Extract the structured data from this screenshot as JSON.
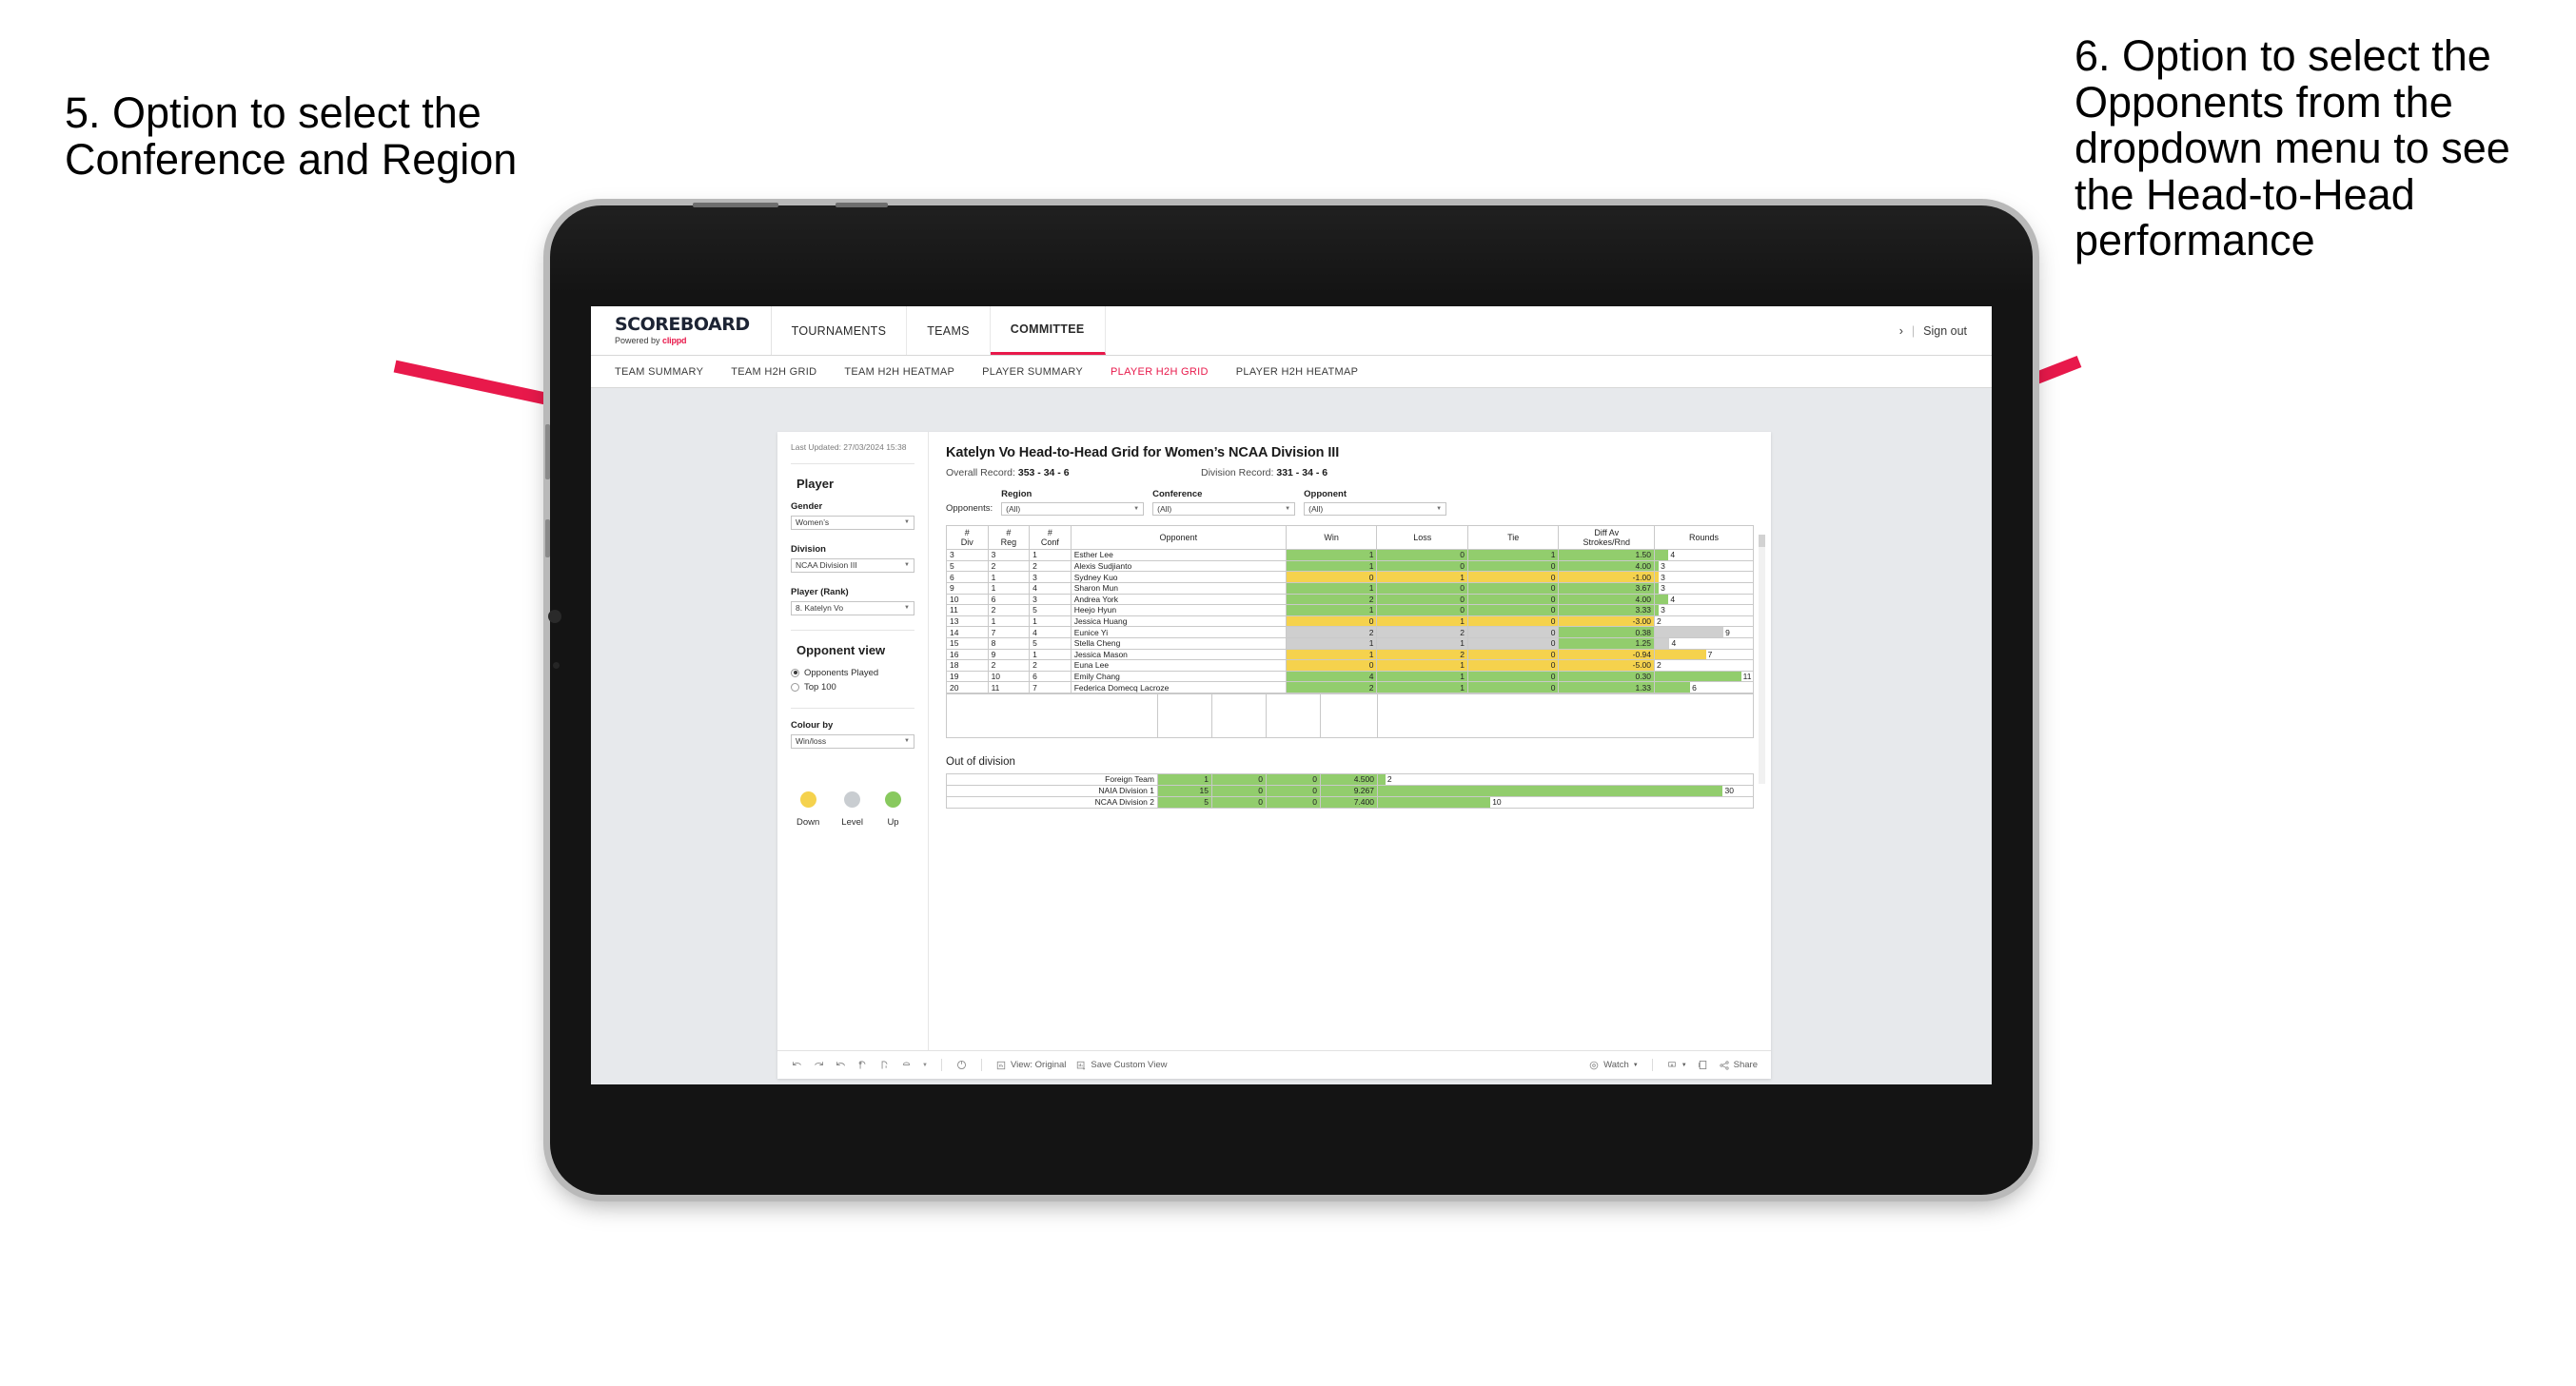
{
  "annotations": {
    "left": "5. Option to select the Conference and Region",
    "right": "6. Option to select the Opponents from the dropdown menu to see the Head-to-Head performance",
    "arrow_color": "#e8194b"
  },
  "app": {
    "brand": {
      "title": "SCOREBOARD",
      "powered_prefix": "Powered by ",
      "powered_brand": "clippd"
    },
    "top_nav": [
      {
        "label": "TOURNAMENTS",
        "active": false
      },
      {
        "label": "TEAMS",
        "active": false
      },
      {
        "label": "COMMITTEE",
        "active": true
      }
    ],
    "header_right": {
      "chevron": "›",
      "separator": "|",
      "sign_out": "Sign out"
    },
    "sub_nav": [
      {
        "label": "TEAM SUMMARY",
        "active": false
      },
      {
        "label": "TEAM H2H GRID",
        "active": false
      },
      {
        "label": "TEAM H2H HEATMAP",
        "active": false
      },
      {
        "label": "PLAYER SUMMARY",
        "active": false
      },
      {
        "label": "PLAYER H2H GRID",
        "active": true
      },
      {
        "label": "PLAYER H2H HEATMAP",
        "active": false
      }
    ]
  },
  "sidebar": {
    "last_updated": "Last Updated: 27/03/2024 15:38",
    "section_player": "Player",
    "gender": {
      "label": "Gender",
      "value": "Women’s"
    },
    "division": {
      "label": "Division",
      "value": "NCAA Division III"
    },
    "player_rank": {
      "label": "Player (Rank)",
      "value": "8. Katelyn Vo"
    },
    "opponent_view": {
      "label": "Opponent view",
      "options": [
        {
          "label": "Opponents Played",
          "checked": true
        },
        {
          "label": "Top 100",
          "checked": false
        }
      ]
    },
    "colour_by": {
      "label": "Colour by",
      "value": "Win/loss"
    },
    "legend": [
      {
        "label": "Down",
        "color": "#f5d24d"
      },
      {
        "label": "Level",
        "color": "#c9cdd1"
      },
      {
        "label": "Up",
        "color": "#88c95e"
      }
    ]
  },
  "main": {
    "title": "Katelyn Vo Head-to-Head Grid for Women’s NCAA Division III",
    "overall_record_label": "Overall Record: ",
    "overall_record_value": "353 - 34 - 6",
    "division_record_label": "Division Record: ",
    "division_record_value": "331 - 34 - 6",
    "opponents_label": "Opponents:",
    "filters": [
      {
        "label": "Region",
        "value": "(All)"
      },
      {
        "label": "Conference",
        "value": "(All)"
      },
      {
        "label": "Opponent",
        "value": "(All)"
      }
    ]
  },
  "chart_data": {
    "type": "table",
    "title": "Katelyn Vo Head-to-Head Grid for Women’s NCAA Division III",
    "columns": [
      "# Div",
      "# Reg",
      "# Conf",
      "Opponent",
      "Win",
      "Loss",
      "Tie",
      "Diff Av Strokes/Rnd",
      "Rounds"
    ],
    "column_header_lines": [
      [
        "#",
        "Div"
      ],
      [
        "#",
        "Reg"
      ],
      [
        "#",
        "Conf"
      ],
      [
        "Opponent"
      ],
      [
        "Win"
      ],
      [
        "Loss"
      ],
      [
        "Tie"
      ],
      [
        "Diff Av",
        "Strokes/Rnd"
      ],
      [
        "Rounds"
      ]
    ],
    "rows": [
      {
        "div": "3",
        "reg": "3",
        "conf": "1",
        "opponent": "Esther Lee",
        "win": "1",
        "loss": "0",
        "tie": "1",
        "diff": "1.50",
        "rounds": "4",
        "color": "green",
        "bar_pct": 14
      },
      {
        "div": "5",
        "reg": "2",
        "conf": "2",
        "opponent": "Alexis Sudjianto",
        "win": "1",
        "loss": "0",
        "tie": "0",
        "diff": "4.00",
        "rounds": "3",
        "color": "green",
        "bar_pct": 4
      },
      {
        "div": "6",
        "reg": "1",
        "conf": "3",
        "opponent": "Sydney Kuo",
        "win": "0",
        "loss": "1",
        "tie": "0",
        "diff": "-1.00",
        "rounds": "3",
        "color": "yellow",
        "bar_pct": 4
      },
      {
        "div": "9",
        "reg": "1",
        "conf": "4",
        "opponent": "Sharon Mun",
        "win": "1",
        "loss": "0",
        "tie": "0",
        "diff": "3.67",
        "rounds": "3",
        "color": "green",
        "bar_pct": 4
      },
      {
        "div": "10",
        "reg": "6",
        "conf": "3",
        "opponent": "Andrea York",
        "win": "2",
        "loss": "0",
        "tie": "0",
        "diff": "4.00",
        "rounds": "4",
        "color": "green",
        "bar_pct": 14
      },
      {
        "div": "11",
        "reg": "2",
        "conf": "5",
        "opponent": "Heejo Hyun",
        "win": "1",
        "loss": "0",
        "tie": "0",
        "diff": "3.33",
        "rounds": "3",
        "color": "green",
        "bar_pct": 4
      },
      {
        "div": "13",
        "reg": "1",
        "conf": "1",
        "opponent": "Jessica Huang",
        "win": "0",
        "loss": "1",
        "tie": "0",
        "diff": "-3.00",
        "rounds": "2",
        "color": "yellow",
        "bar_pct": 0
      },
      {
        "div": "14",
        "reg": "7",
        "conf": "4",
        "opponent": "Eunice Yi",
        "win": "2",
        "loss": "2",
        "tie": "0",
        "diff": "0.38",
        "rounds": "9",
        "color": "grey",
        "bar_pct": 70,
        "diff_color": "green"
      },
      {
        "div": "15",
        "reg": "8",
        "conf": "5",
        "opponent": "Stella Cheng",
        "win": "1",
        "loss": "1",
        "tie": "0",
        "diff": "1.25",
        "rounds": "4",
        "color": "grey",
        "bar_pct": 15,
        "diff_color": "green"
      },
      {
        "div": "16",
        "reg": "9",
        "conf": "1",
        "opponent": "Jessica Mason",
        "win": "1",
        "loss": "2",
        "tie": "0",
        "diff": "-0.94",
        "rounds": "7",
        "color": "yellow",
        "bar_pct": 52
      },
      {
        "div": "18",
        "reg": "2",
        "conf": "2",
        "opponent": "Euna Lee",
        "win": "0",
        "loss": "1",
        "tie": "0",
        "diff": "-5.00",
        "rounds": "2",
        "color": "yellow",
        "bar_pct": 0
      },
      {
        "div": "19",
        "reg": "10",
        "conf": "6",
        "opponent": "Emily Chang",
        "win": "4",
        "loss": "1",
        "tie": "0",
        "diff": "0.30",
        "rounds": "11",
        "color": "green",
        "bar_pct": 88
      },
      {
        "div": "20",
        "reg": "11",
        "conf": "7",
        "opponent": "Federica Domecq Lacroze",
        "win": "2",
        "loss": "1",
        "tie": "0",
        "diff": "1.33",
        "rounds": "6",
        "color": "green",
        "bar_pct": 36
      }
    ],
    "out_of_division": {
      "title": "Out of division",
      "rows": [
        {
          "name": "Foreign Team",
          "win": "1",
          "loss": "0",
          "tie": "0",
          "diff": "4.500",
          "rounds": "2",
          "color": "green",
          "bar_pct": 2
        },
        {
          "name": "NAIA Division 1",
          "win": "15",
          "loss": "0",
          "tie": "0",
          "diff": "9.267",
          "rounds": "30",
          "color": "green",
          "bar_pct": 92
        },
        {
          "name": "NCAA Division 2",
          "win": "5",
          "loss": "0",
          "tie": "0",
          "diff": "7.400",
          "rounds": "10",
          "color": "green",
          "bar_pct": 30
        }
      ]
    },
    "colors": {
      "green": "#92cd6d",
      "yellow": "#f5d24d",
      "grey": "#cfcfcf"
    }
  },
  "toolbar": {
    "view_label": "View: Original",
    "save_label": "Save Custom View",
    "watch_label": "Watch",
    "share_label": "Share"
  }
}
